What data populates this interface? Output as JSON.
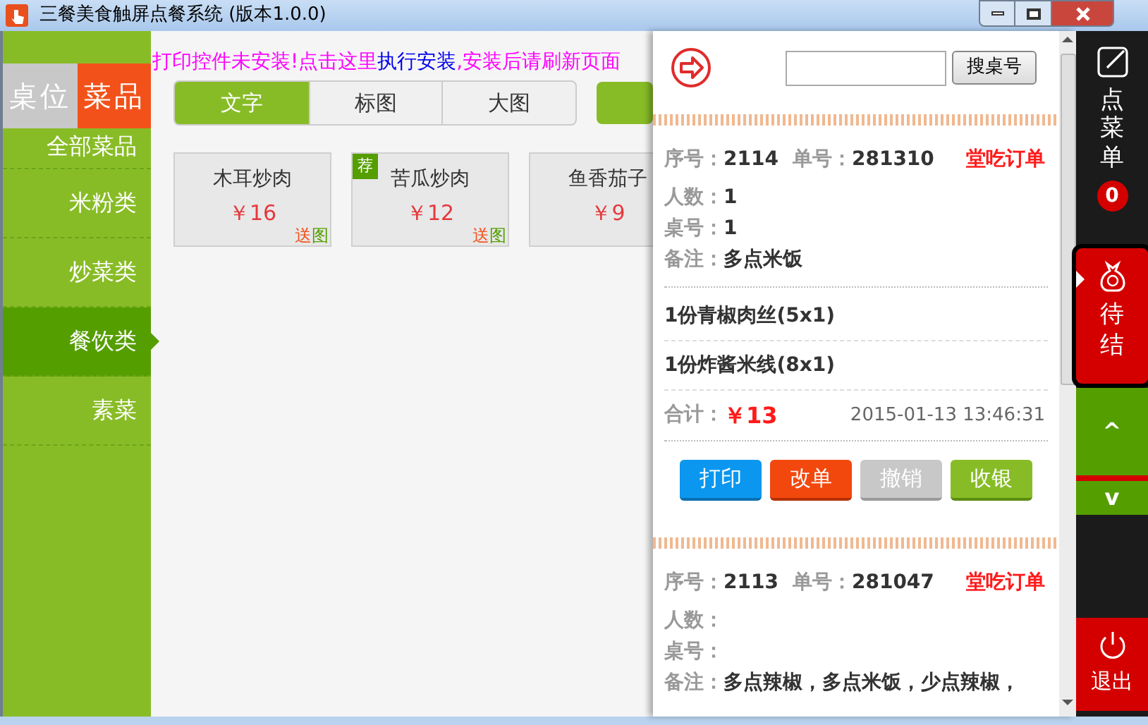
{
  "window": {
    "title": "三餐美食触屏点餐系统 (版本1.0.0)"
  },
  "top_tabs": [
    {
      "label": "桌位",
      "selected": false
    },
    {
      "label": "菜品",
      "selected": true
    }
  ],
  "notice": {
    "before": "打印控件未安装!点击这里",
    "link": "执行安装",
    "after": ",安装后请刷新页面"
  },
  "categories": [
    {
      "label": "全部菜品",
      "selected": false
    },
    {
      "label": "米粉类",
      "selected": false
    },
    {
      "label": "炒菜类",
      "selected": false
    },
    {
      "label": "餐饮类",
      "selected": true
    },
    {
      "label": "素菜",
      "selected": false
    }
  ],
  "view_modes": [
    {
      "label": "文字",
      "selected": true
    },
    {
      "label": "标图",
      "selected": false
    },
    {
      "label": "大图",
      "selected": false
    }
  ],
  "dishes": [
    {
      "name": "木耳炒肉",
      "price": "￥16",
      "recommended": false,
      "tag": [
        "送",
        "图"
      ]
    },
    {
      "name": "苦瓜炒肉",
      "price": "￥12",
      "recommended": true,
      "badge": "荐",
      "tag": [
        "送",
        "图"
      ]
    },
    {
      "name": "鱼香茄子",
      "price": "￥9",
      "recommended": false
    }
  ],
  "order_panel": {
    "search": {
      "button": "搜桌号"
    },
    "orders": [
      {
        "header": [
          {
            "label": "序号：",
            "value": "2114"
          },
          {
            "label": "单号：",
            "value": "281310"
          }
        ],
        "type": "堂吃订单",
        "info": [
          {
            "label": "人数：",
            "value": "1"
          },
          {
            "label": "桌号：",
            "value": "1"
          },
          {
            "label": "备注：",
            "value": "多点米饭"
          }
        ],
        "items": [
          "1份青椒肉丝(5x1)",
          "1份炸酱米线(8x1)"
        ],
        "total": {
          "label": "合计：",
          "value": "￥13"
        },
        "time": "2015-01-13 13:46:31",
        "actions": [
          {
            "label": "打印",
            "kind": "print"
          },
          {
            "label": "改单",
            "kind": "edit"
          },
          {
            "label": "撤销",
            "kind": "cancel"
          },
          {
            "label": "收银",
            "kind": "checkout"
          }
        ]
      },
      {
        "header": [
          {
            "label": "序号：",
            "value": "2113"
          },
          {
            "label": "单号：",
            "value": "281047"
          }
        ],
        "type": "堂吃订单",
        "info": [
          {
            "label": "人数："
          },
          {
            "label": "桌号："
          },
          {
            "label": "备注：",
            "value": "多点辣椒，多点米饭，少点辣椒，"
          }
        ]
      }
    ]
  },
  "rail": [
    {
      "kind": "menu",
      "label": "点菜单",
      "badge": "0",
      "selected": false
    },
    {
      "kind": "pending",
      "label": "待结",
      "selected": true
    },
    {
      "kind": "up",
      "label": "^"
    },
    {
      "kind": "down",
      "label": "v"
    },
    {
      "kind": "exit",
      "label": "退出"
    }
  ]
}
